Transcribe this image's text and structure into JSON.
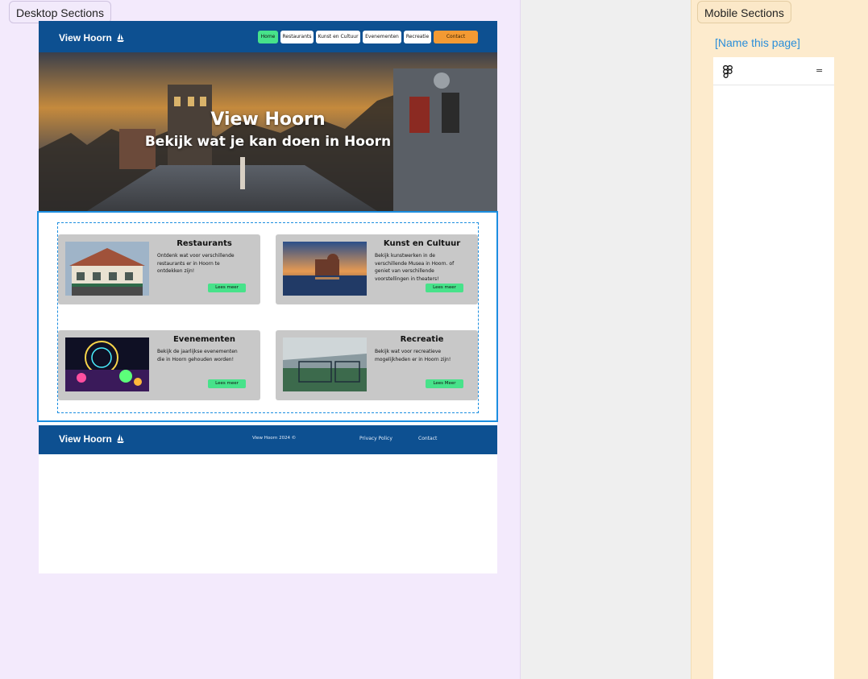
{
  "sections": {
    "desktop_label": "Desktop Sections",
    "mobile_label": "Mobile Sections"
  },
  "desktop": {
    "brand": "View Hoorn",
    "brand_icon": "sailboat-icon",
    "nav": [
      {
        "label": "Home",
        "active": true
      },
      {
        "label": "Restaurants"
      },
      {
        "label": "Kunst en Cultuur"
      },
      {
        "label": "Evenementen"
      },
      {
        "label": "Recreatie"
      },
      {
        "label": "Contact",
        "cta": true
      }
    ],
    "hero": {
      "title": "View Hoorn",
      "subtitle": "Bekijk wat je kan doen in Hoorn"
    },
    "cards": [
      {
        "title": "Restaurants",
        "text": "Ontdenk wat voor verschillende restaurants er in Hoorn te ontdekken zijn!",
        "button": "Lees meer"
      },
      {
        "title": "Kunst en Cultuur",
        "text": "Bekijk kunstwerken in de verschillende Musea in Hoorn. of geniet van verschillende voorstellingen in theaters!",
        "button": "Lees meer"
      },
      {
        "title": "Evenementen",
        "text": "Bekijk de jaarlijkse evenementen die in Hoorn gehouden worden!",
        "button": "Lees meer"
      },
      {
        "title": "Recreatie",
        "text": "Bekijk wat voor recreatieve mogelijkheden er in Hoorn zijn!",
        "button": "Lees Meer"
      }
    ],
    "footer": {
      "brand": "View Hoorn",
      "copyright": "View Hoorn 2024 ©",
      "privacy": "Privacy Policy",
      "contact": "Contact"
    }
  },
  "mobile": {
    "page_name": "[Name this page]",
    "menu_icon": "="
  },
  "colors": {
    "navy": "#0d5091",
    "accent_green": "#47e28a",
    "accent_orange": "#f39a33",
    "selection_blue": "#1c8ee0"
  }
}
